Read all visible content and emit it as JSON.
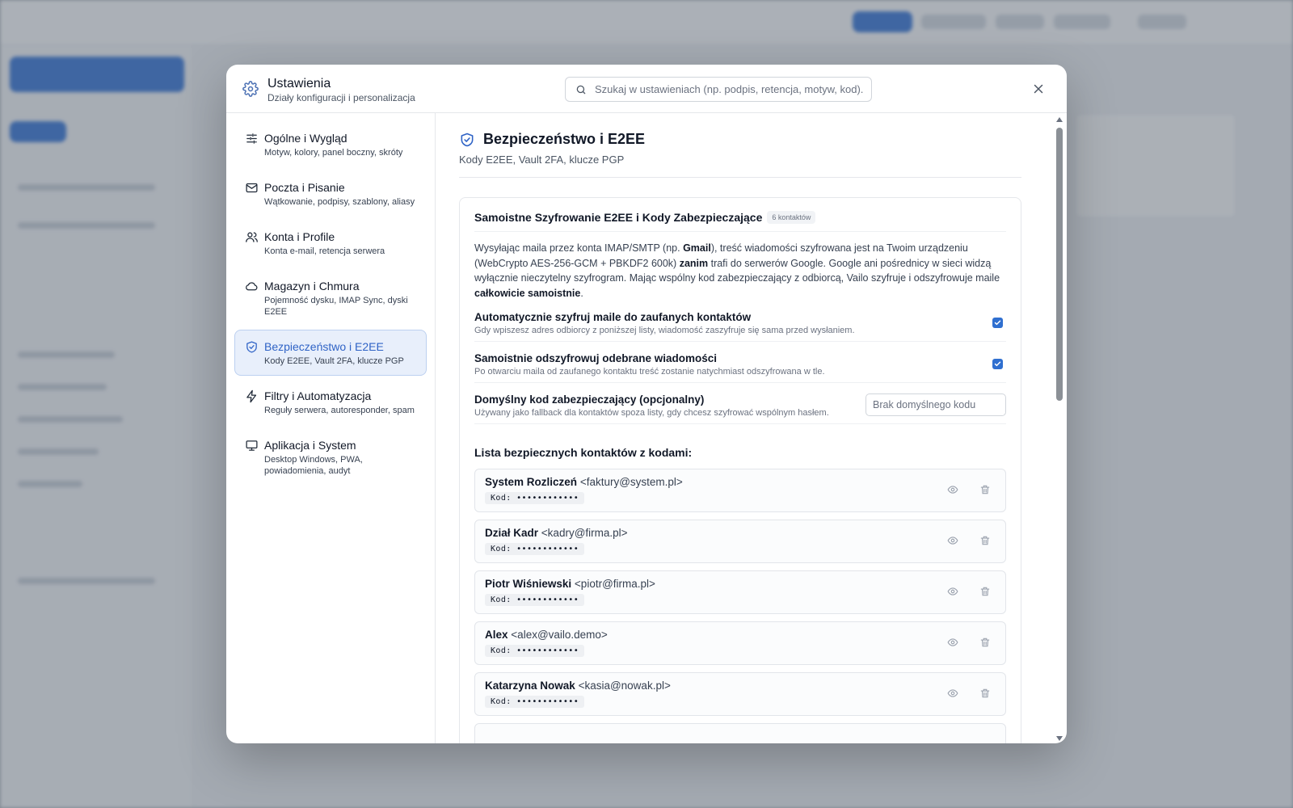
{
  "modal": {
    "title": "Ustawienia",
    "subtitle": "Działy konfiguracji i personalizacja",
    "search_placeholder": "Szukaj w ustawieniach (np. podpis, retencja, motyw, kod)."
  },
  "nav": {
    "items": [
      {
        "title": "Ogólne i Wygląd",
        "desc": "Motyw, kolory, panel boczny, skróty",
        "icon": "sliders-icon"
      },
      {
        "title": "Poczta i Pisanie",
        "desc": "Wątkowanie, podpisy, szablony, aliasy",
        "icon": "mail-icon"
      },
      {
        "title": "Konta i Profile",
        "desc": "Konta e-mail, retencja serwera",
        "icon": "users-icon"
      },
      {
        "title": "Magazyn i Chmura",
        "desc": "Pojemność dysku, IMAP Sync, dyski E2EE",
        "icon": "cloud-icon"
      },
      {
        "title": "Bezpieczeństwo i E2EE",
        "desc": "Kody E2EE, Vault 2FA, klucze PGP",
        "icon": "shield-icon"
      },
      {
        "title": "Filtry i Automatyzacja",
        "desc": "Reguły serwera, autoresponder, spam",
        "icon": "bolt-icon"
      },
      {
        "title": "Aplikacja i System",
        "desc": "Desktop Windows, PWA, powiadomienia, audyt",
        "icon": "monitor-icon"
      }
    ]
  },
  "section": {
    "title": "Bezpieczeństwo i E2EE",
    "subtitle": "Kody E2EE, Vault 2FA, klucze PGP"
  },
  "card": {
    "title": "Samoistne Szyfrowanie E2EE i Kody Zabezpieczające",
    "badge": "6 kontaktów",
    "desc_1": "Wysyłając maila przez konta IMAP/SMTP (np. ",
    "desc_gmail": "Gmail",
    "desc_2": "), treść wiadomości szyfrowana jest na Twoim urządzeniu (WebCrypto AES-256-GCM + PBKDF2 600k) ",
    "desc_zanim": "zanim",
    "desc_3": " trafi do serwerów Google. Google ani pośrednicy w sieci widzą wyłącznie nieczytelny szyfrogram. Mając wspólny kod zabezpieczający z odbiorcą, Vailo szyfruje i odszyfrowuje maile ",
    "desc_bold": "całkowicie samoistnie",
    "desc_4": ".",
    "options": [
      {
        "title": "Automatycznie szyfruj maile do zaufanych kontaktów",
        "desc": "Gdy wpiszesz adres odbiorcy z poniższej listy, wiadomość zaszyfruje się sama przed wysłaniem.",
        "checked": true
      },
      {
        "title": "Samoistnie odszyfrowuj odebrane wiadomości",
        "desc": "Po otwarciu maila od zaufanego kontaktu treść zostanie natychmiast odszyfrowana w tle.",
        "checked": true
      }
    ],
    "default_code": {
      "title": "Domyślny kod zabezpieczający (opcjonalny)",
      "desc": "Używany jako fallback dla kontaktów spoza listy, gdy chcesz szyfrować wspólnym hasłem.",
      "placeholder": "Brak domyślnego kodu"
    },
    "list_title": "Lista bezpiecznych kontaktów z kodami:",
    "contacts": [
      {
        "name": "System Rozliczeń",
        "email": "<faktury@system.pl>",
        "code": "Kod: ••••••••••••"
      },
      {
        "name": "Dział Kadr",
        "email": "<kadry@firma.pl>",
        "code": "Kod: ••••••••••••"
      },
      {
        "name": "Piotr Wiśniewski",
        "email": "<piotr@firma.pl>",
        "code": "Kod: ••••••••••••"
      },
      {
        "name": "Alex",
        "email": "<alex@vailo.demo>",
        "code": "Kod: ••••••••••••"
      },
      {
        "name": "Katarzyna Nowak",
        "email": "<kasia@nowak.pl>",
        "code": "Kod: ••••••••••••"
      }
    ]
  },
  "colors": {
    "accent": "#2f63c6",
    "checkbox": "#2f6fd0"
  }
}
